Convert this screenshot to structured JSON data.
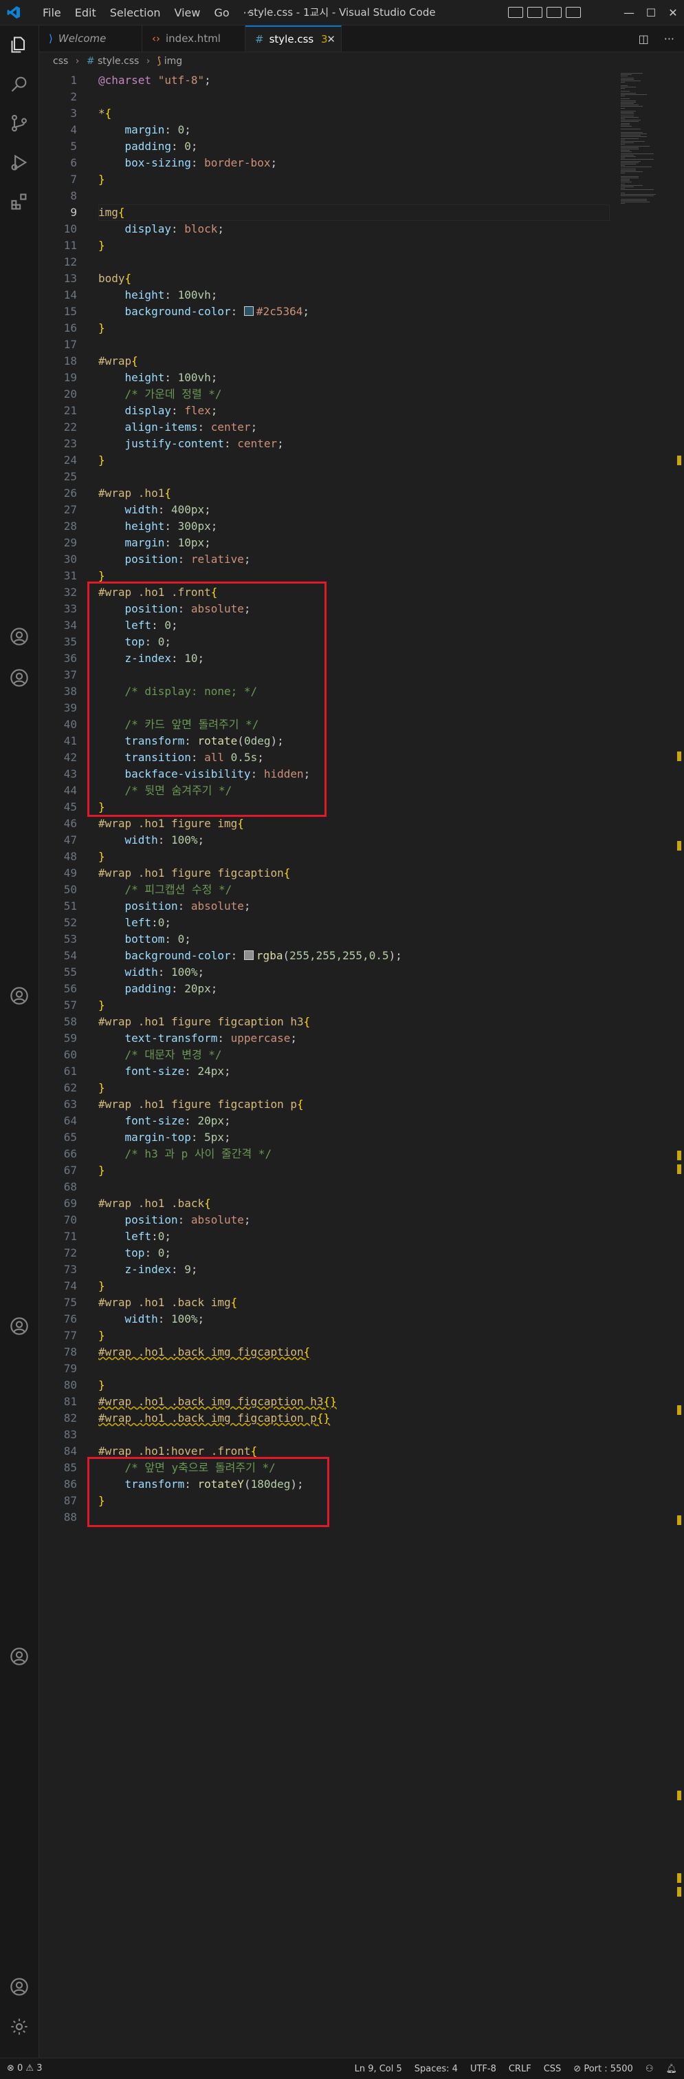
{
  "window": {
    "title": "style.css - 1교시 - Visual Studio Code",
    "menu": [
      "File",
      "Edit",
      "Selection",
      "View",
      "Go",
      "···"
    ],
    "controls": {
      "minimize": "—",
      "maximize": "☐",
      "close": "✕"
    }
  },
  "tabs": [
    {
      "label": "Welcome",
      "icon": "vscode-icon"
    },
    {
      "label": "index.html",
      "icon": "html-icon"
    },
    {
      "label": "style.css",
      "badge": "3",
      "icon": "css-icon",
      "active": true
    }
  ],
  "breadcrumb": {
    "folder": "css",
    "file": "style.css",
    "symbol": "img"
  },
  "editor": {
    "current_line": 9,
    "lines": [
      [
        [
          "t-at",
          "@charset"
        ],
        [
          "t-pl",
          " "
        ],
        [
          "t-str",
          "\"utf-8\""
        ],
        [
          "t-pl",
          ";"
        ]
      ],
      [],
      [
        [
          "t-sel",
          "*"
        ],
        [
          "t-br",
          "{"
        ]
      ],
      [
        [
          "t-pl",
          "    "
        ],
        [
          "t-prop",
          "margin"
        ],
        [
          "t-pl",
          ": "
        ],
        [
          "t-num",
          "0"
        ],
        [
          "t-pl",
          ";"
        ]
      ],
      [
        [
          "t-pl",
          "    "
        ],
        [
          "t-prop",
          "padding"
        ],
        [
          "t-pl",
          ": "
        ],
        [
          "t-num",
          "0"
        ],
        [
          "t-pl",
          ";"
        ]
      ],
      [
        [
          "t-pl",
          "    "
        ],
        [
          "t-prop",
          "box-sizing"
        ],
        [
          "t-pl",
          ": "
        ],
        [
          "t-val",
          "border-box"
        ],
        [
          "t-pl",
          ";"
        ]
      ],
      [
        [
          "t-br",
          "}"
        ]
      ],
      [],
      [
        [
          "t-sel",
          "img"
        ],
        [
          "t-br",
          "{"
        ]
      ],
      [
        [
          "t-pl",
          "    "
        ],
        [
          "t-prop",
          "display"
        ],
        [
          "t-pl",
          ": "
        ],
        [
          "t-val",
          "block"
        ],
        [
          "t-pl",
          ";"
        ]
      ],
      [
        [
          "t-br",
          "}"
        ]
      ],
      [],
      [
        [
          "t-sel",
          "body"
        ],
        [
          "t-br",
          "{"
        ]
      ],
      [
        [
          "t-pl",
          "    "
        ],
        [
          "t-prop",
          "height"
        ],
        [
          "t-pl",
          ": "
        ],
        [
          "t-num",
          "100vh"
        ],
        [
          "t-pl",
          ";"
        ]
      ],
      [
        [
          "t-pl",
          "    "
        ],
        [
          "t-prop",
          "background-color"
        ],
        [
          "t-pl",
          ": "
        ],
        [
          "swatch",
          "#2c5364"
        ],
        [
          "t-val",
          "#2c5364"
        ],
        [
          "t-pl",
          ";"
        ]
      ],
      [
        [
          "t-br",
          "}"
        ]
      ],
      [],
      [
        [
          "t-sel",
          "#wrap"
        ],
        [
          "t-br",
          "{"
        ]
      ],
      [
        [
          "t-pl",
          "    "
        ],
        [
          "t-prop",
          "height"
        ],
        [
          "t-pl",
          ": "
        ],
        [
          "t-num",
          "100vh"
        ],
        [
          "t-pl",
          ";"
        ]
      ],
      [
        [
          "t-pl",
          "    "
        ],
        [
          "t-cm",
          "/* 가운데 정렬 */"
        ]
      ],
      [
        [
          "t-pl",
          "    "
        ],
        [
          "t-prop",
          "display"
        ],
        [
          "t-pl",
          ": "
        ],
        [
          "t-val",
          "flex"
        ],
        [
          "t-pl",
          ";"
        ]
      ],
      [
        [
          "t-pl",
          "    "
        ],
        [
          "t-prop",
          "align-items"
        ],
        [
          "t-pl",
          ": "
        ],
        [
          "t-val",
          "center"
        ],
        [
          "t-pl",
          ";"
        ]
      ],
      [
        [
          "t-pl",
          "    "
        ],
        [
          "t-prop",
          "justify-content"
        ],
        [
          "t-pl",
          ": "
        ],
        [
          "t-val",
          "center"
        ],
        [
          "t-pl",
          ";"
        ]
      ],
      [
        [
          "t-br",
          "}"
        ]
      ],
      [],
      [
        [
          "t-sel",
          "#wrap .ho1"
        ],
        [
          "t-br",
          "{"
        ]
      ],
      [
        [
          "t-pl",
          "    "
        ],
        [
          "t-prop",
          "width"
        ],
        [
          "t-pl",
          ": "
        ],
        [
          "t-num",
          "400px"
        ],
        [
          "t-pl",
          ";"
        ]
      ],
      [
        [
          "t-pl",
          "    "
        ],
        [
          "t-prop",
          "height"
        ],
        [
          "t-pl",
          ": "
        ],
        [
          "t-num",
          "300px"
        ],
        [
          "t-pl",
          ";"
        ]
      ],
      [
        [
          "t-pl",
          "    "
        ],
        [
          "t-prop",
          "margin"
        ],
        [
          "t-pl",
          ": "
        ],
        [
          "t-num",
          "10px"
        ],
        [
          "t-pl",
          ";"
        ]
      ],
      [
        [
          "t-pl",
          "    "
        ],
        [
          "t-prop",
          "position"
        ],
        [
          "t-pl",
          ": "
        ],
        [
          "t-val",
          "relative"
        ],
        [
          "t-pl",
          ";"
        ]
      ],
      [
        [
          "t-br",
          "}"
        ]
      ],
      [
        [
          "t-sel",
          "#wrap .ho1 .front"
        ],
        [
          "t-br",
          "{"
        ]
      ],
      [
        [
          "t-pl",
          "    "
        ],
        [
          "t-prop",
          "position"
        ],
        [
          "t-pl",
          ": "
        ],
        [
          "t-val",
          "absolute"
        ],
        [
          "t-pl",
          ";"
        ]
      ],
      [
        [
          "t-pl",
          "    "
        ],
        [
          "t-prop",
          "left"
        ],
        [
          "t-pl",
          ": "
        ],
        [
          "t-num",
          "0"
        ],
        [
          "t-pl",
          ";"
        ]
      ],
      [
        [
          "t-pl",
          "    "
        ],
        [
          "t-prop",
          "top"
        ],
        [
          "t-pl",
          ": "
        ],
        [
          "t-num",
          "0"
        ],
        [
          "t-pl",
          ";"
        ]
      ],
      [
        [
          "t-pl",
          "    "
        ],
        [
          "t-prop",
          "z-index"
        ],
        [
          "t-pl",
          ": "
        ],
        [
          "t-num",
          "10"
        ],
        [
          "t-pl",
          ";"
        ]
      ],
      [],
      [
        [
          "t-pl",
          "    "
        ],
        [
          "t-cm",
          "/* display: none; */"
        ]
      ],
      [],
      [
        [
          "t-pl",
          "    "
        ],
        [
          "t-cm",
          "/* 카드 앞면 돌려주기 */"
        ]
      ],
      [
        [
          "t-pl",
          "    "
        ],
        [
          "t-prop",
          "transform"
        ],
        [
          "t-pl",
          ": "
        ],
        [
          "t-fn",
          "rotate"
        ],
        [
          "t-pl",
          "("
        ],
        [
          "t-num",
          "0deg"
        ],
        [
          "t-pl",
          ");"
        ]
      ],
      [
        [
          "t-pl",
          "    "
        ],
        [
          "t-prop",
          "transition"
        ],
        [
          "t-pl",
          ": "
        ],
        [
          "t-val",
          "all"
        ],
        [
          "t-pl",
          " "
        ],
        [
          "t-num",
          "0.5s"
        ],
        [
          "t-pl",
          ";"
        ]
      ],
      [
        [
          "t-pl",
          "    "
        ],
        [
          "t-prop",
          "backface-visibility"
        ],
        [
          "t-pl",
          ": "
        ],
        [
          "t-val",
          "hidden"
        ],
        [
          "t-pl",
          ";"
        ]
      ],
      [
        [
          "t-pl",
          "    "
        ],
        [
          "t-cm",
          "/* 뒷면 숨겨주기 */"
        ]
      ],
      [
        [
          "t-br",
          "}"
        ]
      ],
      [
        [
          "t-sel",
          "#wrap .ho1 figure img"
        ],
        [
          "t-br",
          "{"
        ]
      ],
      [
        [
          "t-pl",
          "    "
        ],
        [
          "t-prop",
          "width"
        ],
        [
          "t-pl",
          ": "
        ],
        [
          "t-num",
          "100%"
        ],
        [
          "t-pl",
          ";"
        ]
      ],
      [
        [
          "t-br",
          "}"
        ]
      ],
      [
        [
          "t-sel",
          "#wrap .ho1 figure figcaption"
        ],
        [
          "t-br",
          "{"
        ]
      ],
      [
        [
          "t-pl",
          "    "
        ],
        [
          "t-cm",
          "/* 피그캡션 수정 */"
        ]
      ],
      [
        [
          "t-pl",
          "    "
        ],
        [
          "t-prop",
          "position"
        ],
        [
          "t-pl",
          ": "
        ],
        [
          "t-val",
          "absolute"
        ],
        [
          "t-pl",
          ";"
        ]
      ],
      [
        [
          "t-pl",
          "    "
        ],
        [
          "t-prop",
          "left"
        ],
        [
          "t-pl",
          ":"
        ],
        [
          "t-num",
          "0"
        ],
        [
          "t-pl",
          ";"
        ]
      ],
      [
        [
          "t-pl",
          "    "
        ],
        [
          "t-prop",
          "bottom"
        ],
        [
          "t-pl",
          ": "
        ],
        [
          "t-num",
          "0"
        ],
        [
          "t-pl",
          ";"
        ]
      ],
      [
        [
          "t-pl",
          "    "
        ],
        [
          "t-prop",
          "background-color"
        ],
        [
          "t-pl",
          ": "
        ],
        [
          "swatch",
          "#ffffff80"
        ],
        [
          "t-fn",
          "rgba"
        ],
        [
          "t-pl",
          "("
        ],
        [
          "t-num",
          "255,255,255,0.5"
        ],
        [
          "t-pl",
          ");"
        ]
      ],
      [
        [
          "t-pl",
          "    "
        ],
        [
          "t-prop",
          "width"
        ],
        [
          "t-pl",
          ": "
        ],
        [
          "t-num",
          "100%"
        ],
        [
          "t-pl",
          ";"
        ]
      ],
      [
        [
          "t-pl",
          "    "
        ],
        [
          "t-prop",
          "padding"
        ],
        [
          "t-pl",
          ": "
        ],
        [
          "t-num",
          "20px"
        ],
        [
          "t-pl",
          ";"
        ]
      ],
      [
        [
          "t-br",
          "}"
        ]
      ],
      [
        [
          "t-sel",
          "#wrap .ho1 figure figcaption h3"
        ],
        [
          "t-br",
          "{"
        ]
      ],
      [
        [
          "t-pl",
          "    "
        ],
        [
          "t-prop",
          "text-transform"
        ],
        [
          "t-pl",
          ": "
        ],
        [
          "t-val",
          "uppercase"
        ],
        [
          "t-pl",
          ";"
        ]
      ],
      [
        [
          "t-pl",
          "    "
        ],
        [
          "t-cm",
          "/* 대문자 변경 */"
        ]
      ],
      [
        [
          "t-pl",
          "    "
        ],
        [
          "t-prop",
          "font-size"
        ],
        [
          "t-pl",
          ": "
        ],
        [
          "t-num",
          "24px"
        ],
        [
          "t-pl",
          ";"
        ]
      ],
      [
        [
          "t-br",
          "}"
        ]
      ],
      [
        [
          "t-sel",
          "#wrap .ho1 figure figcaption p"
        ],
        [
          "t-br",
          "{"
        ]
      ],
      [
        [
          "t-pl",
          "    "
        ],
        [
          "t-prop",
          "font-size"
        ],
        [
          "t-pl",
          ": "
        ],
        [
          "t-num",
          "20px"
        ],
        [
          "t-pl",
          ";"
        ]
      ],
      [
        [
          "t-pl",
          "    "
        ],
        [
          "t-prop",
          "margin-top"
        ],
        [
          "t-pl",
          ": "
        ],
        [
          "t-num",
          "5px"
        ],
        [
          "t-pl",
          ";"
        ]
      ],
      [
        [
          "t-pl",
          "    "
        ],
        [
          "t-cm",
          "/* h3 과 p 사이 줄간격 */"
        ]
      ],
      [
        [
          "t-br",
          "}"
        ]
      ],
      [],
      [
        [
          "t-sel",
          "#wrap .ho1 .back"
        ],
        [
          "t-br",
          "{"
        ]
      ],
      [
        [
          "t-pl",
          "    "
        ],
        [
          "t-prop",
          "position"
        ],
        [
          "t-pl",
          ": "
        ],
        [
          "t-val",
          "absolute"
        ],
        [
          "t-pl",
          ";"
        ]
      ],
      [
        [
          "t-pl",
          "    "
        ],
        [
          "t-prop",
          "left"
        ],
        [
          "t-pl",
          ":"
        ],
        [
          "t-num",
          "0"
        ],
        [
          "t-pl",
          ";"
        ]
      ],
      [
        [
          "t-pl",
          "    "
        ],
        [
          "t-prop",
          "top"
        ],
        [
          "t-pl",
          ": "
        ],
        [
          "t-num",
          "0"
        ],
        [
          "t-pl",
          ";"
        ]
      ],
      [
        [
          "t-pl",
          "    "
        ],
        [
          "t-prop",
          "z-index"
        ],
        [
          "t-pl",
          ": "
        ],
        [
          "t-num",
          "9"
        ],
        [
          "t-pl",
          ";"
        ]
      ],
      [
        [
          "t-br",
          "}"
        ]
      ],
      [
        [
          "t-sel",
          "#wrap .ho1 .back img"
        ],
        [
          "t-br",
          "{"
        ]
      ],
      [
        [
          "t-pl",
          "    "
        ],
        [
          "t-prop",
          "width"
        ],
        [
          "t-pl",
          ": "
        ],
        [
          "t-num",
          "100%"
        ],
        [
          "t-pl",
          ";"
        ]
      ],
      [
        [
          "t-br",
          "}"
        ]
      ],
      [
        [
          "t-sel t-sq",
          "#wrap .ho1 .back img figcaption"
        ],
        [
          "t-br t-sq",
          "{"
        ]
      ],
      [],
      [
        [
          "t-br",
          "}"
        ]
      ],
      [
        [
          "t-sel t-sq",
          "#wrap .ho1 .back img figcaption h3"
        ],
        [
          "t-br t-sq",
          "{}"
        ]
      ],
      [
        [
          "t-sel t-sq",
          "#wrap .ho1 .back img figcaption p"
        ],
        [
          "t-br t-sq",
          "{}"
        ]
      ],
      [],
      [
        [
          "t-sel",
          "#wrap .ho1:hover .front"
        ],
        [
          "t-br",
          "{"
        ]
      ],
      [
        [
          "t-pl",
          "    "
        ],
        [
          "t-cm",
          "/* 앞면 y축으로 돌려주기 */"
        ]
      ],
      [
        [
          "t-pl",
          "    "
        ],
        [
          "t-prop",
          "transform"
        ],
        [
          "t-pl",
          ": "
        ],
        [
          "t-fn",
          "rotateY"
        ],
        [
          "t-pl",
          "("
        ],
        [
          "t-num",
          "180deg"
        ],
        [
          "t-pl",
          ");"
        ]
      ],
      [
        [
          "t-br",
          "}"
        ]
      ],
      []
    ]
  },
  "highlights": [
    {
      "from": 32,
      "to": 45
    },
    {
      "from": 85,
      "to": 88
    }
  ],
  "status": {
    "problems": "⊗ 0 ⚠ 3",
    "position": "Ln 9, Col 5",
    "spaces": "Spaces: 4",
    "encoding": "UTF-8",
    "eol": "CRLF",
    "language": "CSS",
    "port": "⊘ Port : 5500"
  },
  "colors": {
    "accent": "#0078d4",
    "highlight_box": "#e0192a"
  }
}
